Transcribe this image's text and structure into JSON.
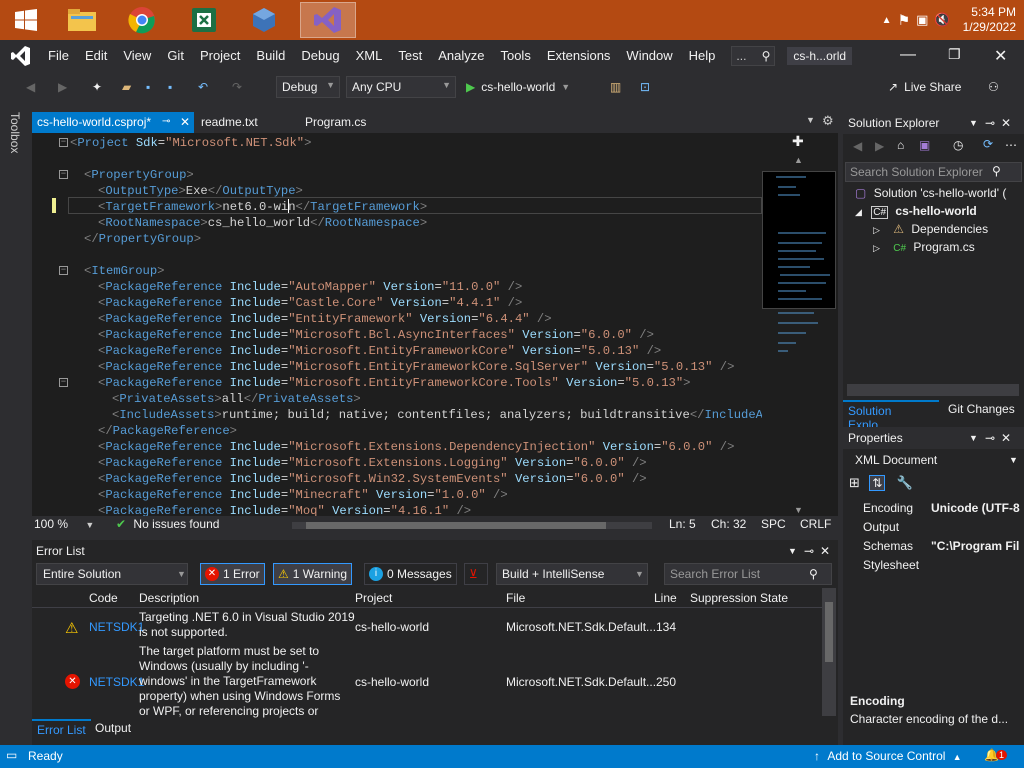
{
  "taskbar": {
    "icons": [
      "windows-start",
      "file-explorer",
      "chrome",
      "excel",
      "virtualbox",
      "visual-studio"
    ],
    "clock_time": "5:34 PM",
    "clock_date": "1/29/2022"
  },
  "menubar": {
    "items": [
      "File",
      "Edit",
      "View",
      "Git",
      "Project",
      "Build",
      "Debug",
      "XML",
      "Test",
      "Analyze",
      "Tools",
      "Extensions",
      "Window",
      "Help"
    ],
    "search_placeholder": "...",
    "solution_name": "cs-h...orld"
  },
  "toolbar": {
    "config": "Debug",
    "platform": "Any CPU",
    "run_target": "cs-hello-world",
    "live_share": "Live Share"
  },
  "sidebar": {
    "toolbox_label": "Toolbox"
  },
  "tabs": [
    {
      "label": "cs-hello-world.csproj*",
      "active": true
    },
    {
      "label": "readme.txt",
      "active": false
    },
    {
      "label": "Program.cs",
      "active": false
    }
  ],
  "editor": {
    "lines": [
      {
        "indent": 0,
        "parts": [
          [
            "p",
            "<"
          ],
          [
            "t",
            "Project"
          ],
          [
            "a",
            " Sdk"
          ],
          [
            "x",
            "="
          ],
          [
            "v",
            "\"Microsoft.NET.Sdk\""
          ],
          [
            "p",
            ">"
          ]
        ]
      },
      {
        "indent": 0,
        "parts": []
      },
      {
        "indent": 1,
        "parts": [
          [
            "p",
            "<"
          ],
          [
            "t",
            "PropertyGroup"
          ],
          [
            "p",
            ">"
          ]
        ]
      },
      {
        "indent": 2,
        "parts": [
          [
            "p",
            "<"
          ],
          [
            "t",
            "OutputType"
          ],
          [
            "p",
            ">"
          ],
          [
            "x",
            "Exe"
          ],
          [
            "p",
            "</"
          ],
          [
            "t",
            "OutputType"
          ],
          [
            "p",
            ">"
          ]
        ]
      },
      {
        "indent": 2,
        "parts": [
          [
            "p",
            "<"
          ],
          [
            "t",
            "TargetFramework"
          ],
          [
            "p",
            ">"
          ],
          [
            "x",
            "net6.0-win"
          ],
          [
            "p",
            "</"
          ],
          [
            "t",
            "TargetFramework"
          ],
          [
            "p",
            ">"
          ]
        ]
      },
      {
        "indent": 2,
        "parts": [
          [
            "p",
            "<"
          ],
          [
            "t",
            "RootNamespace"
          ],
          [
            "p",
            ">"
          ],
          [
            "x",
            "cs_hello_world"
          ],
          [
            "p",
            "</"
          ],
          [
            "t",
            "RootNamespace"
          ],
          [
            "p",
            ">"
          ]
        ]
      },
      {
        "indent": 1,
        "parts": [
          [
            "p",
            "</"
          ],
          [
            "t",
            "PropertyGroup"
          ],
          [
            "p",
            ">"
          ]
        ]
      },
      {
        "indent": 0,
        "parts": []
      },
      {
        "indent": 1,
        "parts": [
          [
            "p",
            "<"
          ],
          [
            "t",
            "ItemGroup"
          ],
          [
            "p",
            ">"
          ]
        ]
      },
      {
        "indent": 2,
        "parts": [
          [
            "p",
            "<"
          ],
          [
            "t",
            "PackageReference"
          ],
          [
            "a",
            " Include"
          ],
          [
            "x",
            "="
          ],
          [
            "v",
            "\"AutoMapper\""
          ],
          [
            "a",
            " Version"
          ],
          [
            "x",
            "="
          ],
          [
            "v",
            "\"11.0.0\""
          ],
          [
            "p",
            " />"
          ]
        ]
      },
      {
        "indent": 2,
        "parts": [
          [
            "p",
            "<"
          ],
          [
            "t",
            "PackageReference"
          ],
          [
            "a",
            " Include"
          ],
          [
            "x",
            "="
          ],
          [
            "v",
            "\"Castle.Core\""
          ],
          [
            "a",
            " Version"
          ],
          [
            "x",
            "="
          ],
          [
            "v",
            "\"4.4.1\""
          ],
          [
            "p",
            " />"
          ]
        ]
      },
      {
        "indent": 2,
        "parts": [
          [
            "p",
            "<"
          ],
          [
            "t",
            "PackageReference"
          ],
          [
            "a",
            " Include"
          ],
          [
            "x",
            "="
          ],
          [
            "v",
            "\"EntityFramework\""
          ],
          [
            "a",
            " Version"
          ],
          [
            "x",
            "="
          ],
          [
            "v",
            "\"6.4.4\""
          ],
          [
            "p",
            " />"
          ]
        ]
      },
      {
        "indent": 2,
        "parts": [
          [
            "p",
            "<"
          ],
          [
            "t",
            "PackageReference"
          ],
          [
            "a",
            " Include"
          ],
          [
            "x",
            "="
          ],
          [
            "v",
            "\"Microsoft.Bcl.AsyncInterfaces\""
          ],
          [
            "a",
            " Version"
          ],
          [
            "x",
            "="
          ],
          [
            "v",
            "\"6.0.0\""
          ],
          [
            "p",
            " />"
          ]
        ]
      },
      {
        "indent": 2,
        "parts": [
          [
            "p",
            "<"
          ],
          [
            "t",
            "PackageReference"
          ],
          [
            "a",
            " Include"
          ],
          [
            "x",
            "="
          ],
          [
            "v",
            "\"Microsoft.EntityFrameworkCore\""
          ],
          [
            "a",
            " Version"
          ],
          [
            "x",
            "="
          ],
          [
            "v",
            "\"5.0.13\""
          ],
          [
            "p",
            " />"
          ]
        ]
      },
      {
        "indent": 2,
        "parts": [
          [
            "p",
            "<"
          ],
          [
            "t",
            "PackageReference"
          ],
          [
            "a",
            " Include"
          ],
          [
            "x",
            "="
          ],
          [
            "v",
            "\"Microsoft.EntityFrameworkCore.SqlServer\""
          ],
          [
            "a",
            " Version"
          ],
          [
            "x",
            "="
          ],
          [
            "v",
            "\"5.0.13\""
          ],
          [
            "p",
            " />"
          ]
        ]
      },
      {
        "indent": 2,
        "parts": [
          [
            "p",
            "<"
          ],
          [
            "t",
            "PackageReference"
          ],
          [
            "a",
            " Include"
          ],
          [
            "x",
            "="
          ],
          [
            "v",
            "\"Microsoft.EntityFrameworkCore.Tools\""
          ],
          [
            "a",
            " Version"
          ],
          [
            "x",
            "="
          ],
          [
            "v",
            "\"5.0.13\""
          ],
          [
            "p",
            ">"
          ]
        ]
      },
      {
        "indent": 3,
        "parts": [
          [
            "p",
            "<"
          ],
          [
            "t",
            "PrivateAssets"
          ],
          [
            "p",
            ">"
          ],
          [
            "x",
            "all"
          ],
          [
            "p",
            "</"
          ],
          [
            "t",
            "PrivateAssets"
          ],
          [
            "p",
            ">"
          ]
        ]
      },
      {
        "indent": 3,
        "parts": [
          [
            "p",
            "<"
          ],
          [
            "t",
            "IncludeAssets"
          ],
          [
            "p",
            ">"
          ],
          [
            "x",
            "runtime; build; native; contentfiles; analyzers; buildtransitive"
          ],
          [
            "p",
            "</"
          ],
          [
            "t",
            "IncludeAsset"
          ]
        ]
      },
      {
        "indent": 2,
        "parts": [
          [
            "p",
            "</"
          ],
          [
            "t",
            "PackageReference"
          ],
          [
            "p",
            ">"
          ]
        ]
      },
      {
        "indent": 2,
        "parts": [
          [
            "p",
            "<"
          ],
          [
            "t",
            "PackageReference"
          ],
          [
            "a",
            " Include"
          ],
          [
            "x",
            "="
          ],
          [
            "v",
            "\"Microsoft.Extensions.DependencyInjection\""
          ],
          [
            "a",
            " Version"
          ],
          [
            "x",
            "="
          ],
          [
            "v",
            "\"6.0.0\""
          ],
          [
            "p",
            " />"
          ]
        ]
      },
      {
        "indent": 2,
        "parts": [
          [
            "p",
            "<"
          ],
          [
            "t",
            "PackageReference"
          ],
          [
            "a",
            " Include"
          ],
          [
            "x",
            "="
          ],
          [
            "v",
            "\"Microsoft.Extensions.Logging\""
          ],
          [
            "a",
            " Version"
          ],
          [
            "x",
            "="
          ],
          [
            "v",
            "\"6.0.0\""
          ],
          [
            "p",
            " />"
          ]
        ]
      },
      {
        "indent": 2,
        "parts": [
          [
            "p",
            "<"
          ],
          [
            "t",
            "PackageReference"
          ],
          [
            "a",
            " Include"
          ],
          [
            "x",
            "="
          ],
          [
            "v",
            "\"Microsoft.Win32.SystemEvents\""
          ],
          [
            "a",
            " Version"
          ],
          [
            "x",
            "="
          ],
          [
            "v",
            "\"6.0.0\""
          ],
          [
            "p",
            " />"
          ]
        ]
      },
      {
        "indent": 2,
        "parts": [
          [
            "p",
            "<"
          ],
          [
            "t",
            "PackageReference"
          ],
          [
            "a",
            " Include"
          ],
          [
            "x",
            "="
          ],
          [
            "v",
            "\"Minecraft\""
          ],
          [
            "a",
            " Version"
          ],
          [
            "x",
            "="
          ],
          [
            "v",
            "\"1.0.0\""
          ],
          [
            "p",
            " />"
          ]
        ]
      },
      {
        "indent": 2,
        "parts": [
          [
            "p",
            "<"
          ],
          [
            "t",
            "PackageReference"
          ],
          [
            "a",
            " Include"
          ],
          [
            "x",
            "="
          ],
          [
            "v",
            "\"Moq\""
          ],
          [
            "a",
            " Version"
          ],
          [
            "x",
            "="
          ],
          [
            "v",
            "\"4.16.1\""
          ],
          [
            "p",
            " />"
          ]
        ]
      }
    ]
  },
  "editor_status": {
    "zoom": "100 %",
    "issues": "No issues found",
    "ln": "Ln: 5",
    "ch": "Ch: 32",
    "spc": "SPC",
    "crlf": "CRLF"
  },
  "solution_explorer": {
    "title": "Solution Explorer",
    "search_placeholder": "Search Solution Explorer (",
    "solution": "Solution 'cs-hello-world' (",
    "project": "cs-hello-world",
    "dependencies": "Dependencies",
    "program": "Program.cs",
    "tab_solution": "Solution Explo...",
    "tab_git": "Git Changes"
  },
  "properties": {
    "title": "Properties",
    "object": "XML Document",
    "rows": [
      {
        "name": "Encoding",
        "value": "Unicode (UTF-8"
      },
      {
        "name": "Output",
        "value": ""
      },
      {
        "name": "Schemas",
        "value": "\"C:\\Program Fil"
      },
      {
        "name": "Stylesheet",
        "value": ""
      }
    ],
    "desc_title": "Encoding",
    "desc_text": "Character encoding of the d..."
  },
  "error_list": {
    "title": "Error List",
    "scope": "Entire Solution",
    "errors_btn": "1 Error",
    "warnings_btn": "1 Warning",
    "messages_btn": "0 Messages",
    "build_filter": "Build + IntelliSense",
    "search_placeholder": "Search Error List",
    "columns": [
      "Code",
      "Description",
      "Project",
      "File",
      "Line",
      "Suppression State"
    ],
    "rows": [
      {
        "severity": "warning",
        "code": "NETSDK1",
        "desc_lines": [
          "Targeting .NET 6.0 in Visual Studio 2019",
          "is not supported."
        ],
        "project": "cs-hello-world",
        "file": "Microsoft.NET.Sdk.Default...",
        "line": "134"
      },
      {
        "severity": "error",
        "code": "NETSDK1",
        "desc_lines": [
          "The target platform must be set to",
          "Windows (usually by including '-",
          "windows' in the TargetFramework",
          "property) when using Windows Forms",
          "or WPF, or referencing projects or"
        ],
        "project": "cs-hello-world",
        "file": "Microsoft.NET.Sdk.Default...",
        "line": "250"
      }
    ],
    "tab_errors": "Error List",
    "tab_output": "Output"
  },
  "statusbar": {
    "ready": "Ready",
    "source_control": "Add to Source Control",
    "notif_count": "1"
  },
  "colors": {
    "accent": "#007acc",
    "taskbar": "#b44a12",
    "error": "#e51400",
    "warning": "#ffcc00"
  }
}
